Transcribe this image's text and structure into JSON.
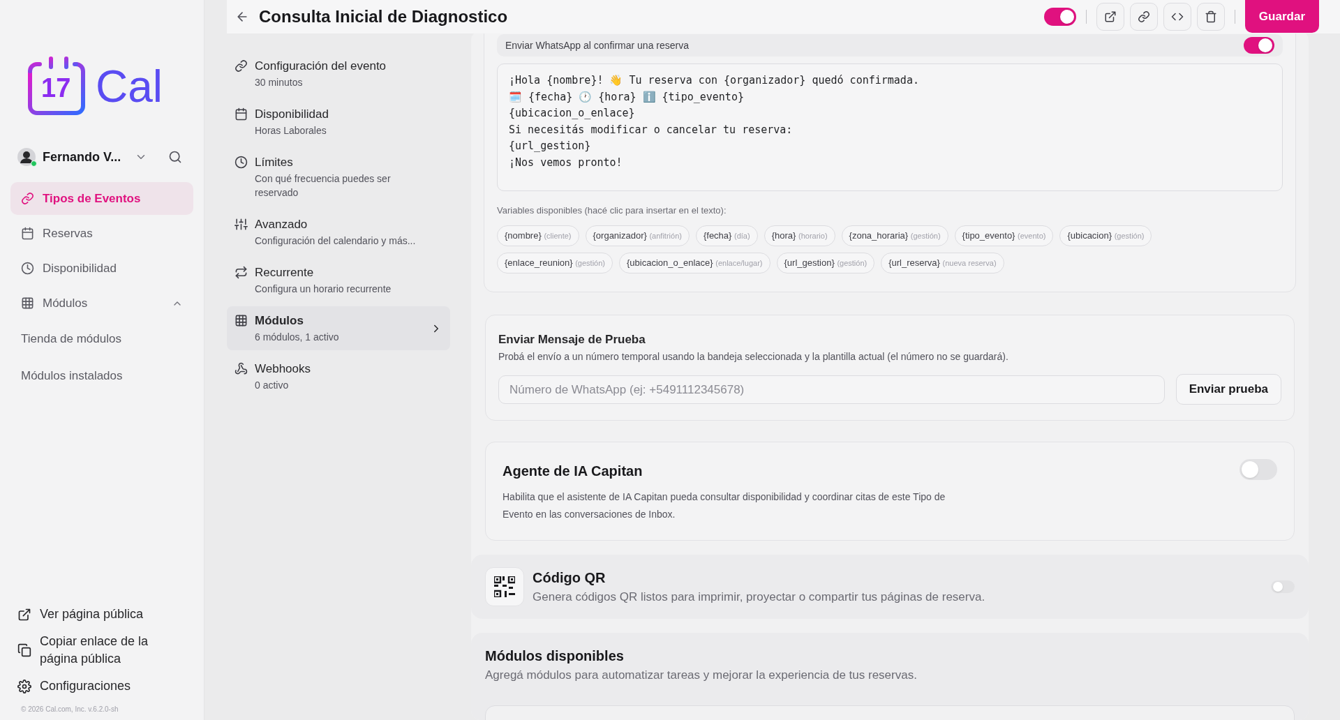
{
  "header": {
    "title": "Consulta Inicial de Diagnostico",
    "enabled": true,
    "save_button": "Guardar"
  },
  "sidebar": {
    "logo": {
      "number": "17",
      "name": "Cal"
    },
    "user": {
      "name": "Fernando V...",
      "online": true
    },
    "nav": [
      {
        "label": "Tipos de Eventos",
        "selected": true
      },
      {
        "label": "Reservas",
        "selected": false
      },
      {
        "label": "Disponibilidad",
        "selected": false
      },
      {
        "label": "Módulos",
        "selected": false,
        "expanded": true,
        "children": [
          {
            "label": "Tienda de módulos"
          },
          {
            "label": "Módulos instalados"
          }
        ]
      }
    ],
    "footer_links": [
      {
        "label": "Ver página pública"
      },
      {
        "label": "Copiar enlace de la página pública"
      },
      {
        "label": "Configuraciones"
      }
    ],
    "copyright": "© 2026 Cal.com, Inc. v.6.2.0-sh"
  },
  "settings_nav": [
    {
      "title": "Configuración del evento",
      "subtitle": "30 minutos",
      "selected": false
    },
    {
      "title": "Disponibilidad",
      "subtitle": "Horas Laborales",
      "selected": false
    },
    {
      "title": "Límites",
      "subtitle": "Con qué frecuencia puedes ser reservado",
      "selected": false
    },
    {
      "title": "Avanzado",
      "subtitle": "Configuración del calendario y más...",
      "selected": false
    },
    {
      "title": "Recurrente",
      "subtitle": "Configura un horario recurrente",
      "selected": false
    },
    {
      "title": "Módulos",
      "subtitle": "6 módulos, 1 activo",
      "selected": true
    },
    {
      "title": "Webhooks",
      "subtitle": "0 activo",
      "selected": false
    }
  ],
  "whatsapp_confirmation": {
    "label": "Enviar WhatsApp al confirmar una reserva",
    "on": true,
    "message": "¡Hola {nombre}! 👋 Tu reserva con {organizador} quedó confirmada.\n🗓️ {fecha} 🕐 {hora} ℹ️ {tipo_evento}\n{ubicacion_o_enlace}\nSi necesitás modificar o cancelar tu reserva:\n{url_gestion}\n¡Nos vemos pronto!",
    "variables_label": "Variables disponibles (hacé clic para insertar en el texto):",
    "variables": [
      {
        "name": "{nombre}",
        "hint": "(cliente)"
      },
      {
        "name": "{organizador}",
        "hint": "(anfitrión)"
      },
      {
        "name": "{fecha}",
        "hint": "(día)"
      },
      {
        "name": "{hora}",
        "hint": "(horario)"
      },
      {
        "name": "{zona_horaria}",
        "hint": "(gestión)"
      },
      {
        "name": "{tipo_evento}",
        "hint": "(evento)"
      },
      {
        "name": "{ubicacion}",
        "hint": "(gestión)"
      },
      {
        "name": "{enlace_reunion}",
        "hint": "(gestión)"
      },
      {
        "name": "{ubicacion_o_enlace}",
        "hint": "(enlace/lugar)"
      },
      {
        "name": "{url_gestion}",
        "hint": "(gestión)"
      },
      {
        "name": "{url_reserva}",
        "hint": "(nueva reserva)"
      }
    ]
  },
  "test_message": {
    "title": "Enviar Mensaje de Prueba",
    "description": "Probá el envío a un número temporal usando la bandeja seleccionada y la plantilla actual (el número no se guardará).",
    "placeholder": "Número de WhatsApp (ej: +5491112345678)",
    "button": "Enviar prueba"
  },
  "ai_agent": {
    "title": "Agente de IA Capitan",
    "description": "Habilita que el asistente de IA Capitan pueda consultar disponibilidad y coordinar citas de este Tipo de Evento en las conversaciones de Inbox.",
    "on": false
  },
  "qr_module": {
    "title": "Código QR",
    "description": "Genera códigos QR listos para imprimir, proyectar o compartir tus páginas de reserva.",
    "on": false
  },
  "available_modules": {
    "title": "Módulos disponibles",
    "description": "Agregá módulos para automatizar tareas y mejorar la experiencia de tus reservas."
  }
}
